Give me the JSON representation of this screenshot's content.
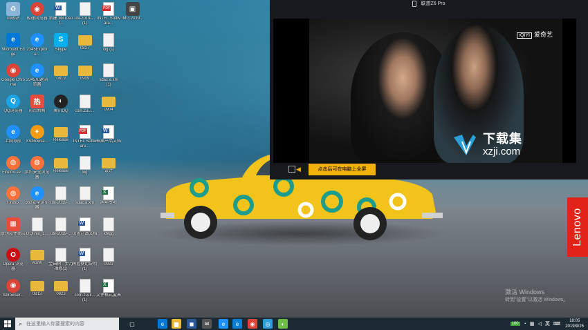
{
  "desktop": {
    "icons": [
      {
        "label": "回收站",
        "type": "recycle",
        "col": 0,
        "row": 0
      },
      {
        "label": "极速浏览器",
        "type": "chrome",
        "col": 1,
        "row": 0
      },
      {
        "label": "新建 Microsof...",
        "type": "word",
        "col": 2,
        "row": 0
      },
      {
        "label": "util-2019-... (1)",
        "type": "file",
        "col": 3,
        "row": 0
      },
      {
        "label": "INTEL Software...",
        "type": "pdf",
        "col": 4,
        "row": 0
      },
      {
        "label": "IMG 2019...",
        "type": "image",
        "col": 5,
        "row": 0
      },
      {
        "label": "Microsoft Edge",
        "type": "edge",
        "col": 0,
        "row": 1
      },
      {
        "label": "2345Explore...",
        "type": "ie",
        "col": 1,
        "row": 1
      },
      {
        "label": "Skype",
        "type": "skype",
        "col": 2,
        "row": 1
      },
      {
        "label": "0827",
        "type": "folder",
        "col": 3,
        "row": 1
      },
      {
        "label": "log (1)",
        "type": "file",
        "col": 4,
        "row": 1
      },
      {
        "label": "Google Chrome",
        "type": "chrome",
        "col": 0,
        "row": 2
      },
      {
        "label": "2345加速浏览器",
        "type": "ie",
        "col": 1,
        "row": 2
      },
      {
        "label": "0819",
        "type": "folder",
        "col": 2,
        "row": 2
      },
      {
        "label": "0909",
        "type": "folder",
        "col": 3,
        "row": 2
      },
      {
        "label": "sdac.a.xm (1)",
        "type": "file",
        "col": 4,
        "row": 2
      },
      {
        "label": "QQ浏览器",
        "type": "qqbrowser",
        "col": 0,
        "row": 3
      },
      {
        "label": "热点新闻",
        "type": "news",
        "col": 1,
        "row": 3
      },
      {
        "label": "腾讯QQ",
        "type": "qq",
        "col": 2,
        "row": 3
      },
      {
        "label": "com.zui.i...",
        "type": "file",
        "col": 3,
        "row": 3
      },
      {
        "label": "0904",
        "type": "folder",
        "col": 4,
        "row": 3
      },
      {
        "label": "上网导航",
        "type": "ie",
        "col": 0,
        "row": 4
      },
      {
        "label": "XSbrowse...",
        "type": "xs",
        "col": 1,
        "row": 4
      },
      {
        "label": "Release",
        "type": "folder",
        "col": 2,
        "row": 4
      },
      {
        "label": "INTEL Software...",
        "type": "pdf",
        "col": 3,
        "row": 4
      },
      {
        "label": "档案产品文档",
        "type": "word",
        "col": 4,
        "row": 4
      },
      {
        "label": "Firefox-se...",
        "type": "firefox",
        "col": 0,
        "row": 5
      },
      {
        "label": "猎豹安全浏览器",
        "type": "firefox",
        "col": 1,
        "row": 5
      },
      {
        "label": "Release",
        "type": "folder",
        "col": 2,
        "row": 5
      },
      {
        "label": "log",
        "type": "file",
        "col": 3,
        "row": 5
      },
      {
        "label": "设计",
        "type": "folder",
        "col": 4,
        "row": 5
      },
      {
        "label": "Firefox",
        "type": "firefox",
        "col": 0,
        "row": 6
      },
      {
        "label": "360安全浏览器",
        "type": "ie",
        "col": 1,
        "row": 6
      },
      {
        "label": "util-2019-...",
        "type": "file",
        "col": 2,
        "row": 6
      },
      {
        "label": "sdac.a.xm",
        "type": "file",
        "col": 3,
        "row": 6
      },
      {
        "label": "两年专项",
        "type": "excel",
        "col": 4,
        "row": 6
      },
      {
        "label": "联想软件商店",
        "type": "store",
        "col": 0,
        "row": 7
      },
      {
        "label": "QQlinle_1...",
        "type": "file",
        "col": 1,
        "row": 7
      },
      {
        "label": "util-2019-...",
        "type": "file",
        "col": 2,
        "row": 7
      },
      {
        "label": "设置产品文档",
        "type": "word",
        "col": 3,
        "row": 7
      },
      {
        "label": "khlgg",
        "type": "file",
        "col": 4,
        "row": 7
      },
      {
        "label": "Opera 浏览器",
        "type": "opera",
        "col": 0,
        "row": 8
      },
      {
        "label": "AtoW",
        "type": "folder",
        "col": 1,
        "row": 8
      },
      {
        "label": "金田树 - 步月禅修(1)",
        "type": "file",
        "col": 2,
        "row": 8
      },
      {
        "label": "再看使用说明(1)",
        "type": "word",
        "col": 3,
        "row": 8
      },
      {
        "label": "0923",
        "type": "file",
        "col": 4,
        "row": 8
      },
      {
        "label": "tsbrowser...",
        "type": "chrome",
        "col": 0,
        "row": 9
      },
      {
        "label": "0813",
        "type": "folder",
        "col": 1,
        "row": 9
      },
      {
        "label": "0823",
        "type": "folder",
        "col": 2,
        "row": 9
      },
      {
        "label": "com.zui.ll... (1)",
        "type": "file",
        "col": 3,
        "row": 9
      },
      {
        "label": "文件格式要表",
        "type": "excel",
        "col": 4,
        "row": 9
      }
    ],
    "activate_windows": {
      "title": "激活 Windows",
      "subtitle": "转到\"设置\"以激活 Windows。"
    },
    "lenovo_tab": "Lenovo"
  },
  "mirror": {
    "title": "联想Z6 Pro",
    "video_brand_logo": "iQIYI",
    "video_brand": "爱奇艺",
    "watermark_cn": "下载集",
    "watermark_url": "xzji.com",
    "fullscreen_tip": "点击后可在电脑上全屏"
  },
  "taskbar": {
    "search_placeholder": "在这里输入你要搜索的内容",
    "apps": [
      {
        "name": "task-view",
        "color": "#1c2a33",
        "glyph": "▢"
      },
      {
        "name": "edge",
        "color": "#0078d7",
        "glyph": "e"
      },
      {
        "name": "file-explorer",
        "color": "#e8b93a",
        "glyph": "▆"
      },
      {
        "name": "store",
        "color": "#2b5797",
        "glyph": "◼"
      },
      {
        "name": "mail",
        "color": "#555",
        "glyph": "✉"
      },
      {
        "name": "ie",
        "color": "#1e90ff",
        "glyph": "e"
      },
      {
        "name": "edge-2",
        "color": "#0a7fd4",
        "glyph": "e"
      },
      {
        "name": "chrome",
        "color": "#db4437",
        "glyph": "◉"
      },
      {
        "name": "browser",
        "color": "#2d9cdb",
        "glyph": "◎"
      },
      {
        "name": "lenovo-app",
        "color": "#6dbd45",
        "glyph": "◐"
      }
    ],
    "tray_battery": "100",
    "tray_ime": "英",
    "time": "18:05",
    "date": "2019/9/25"
  }
}
